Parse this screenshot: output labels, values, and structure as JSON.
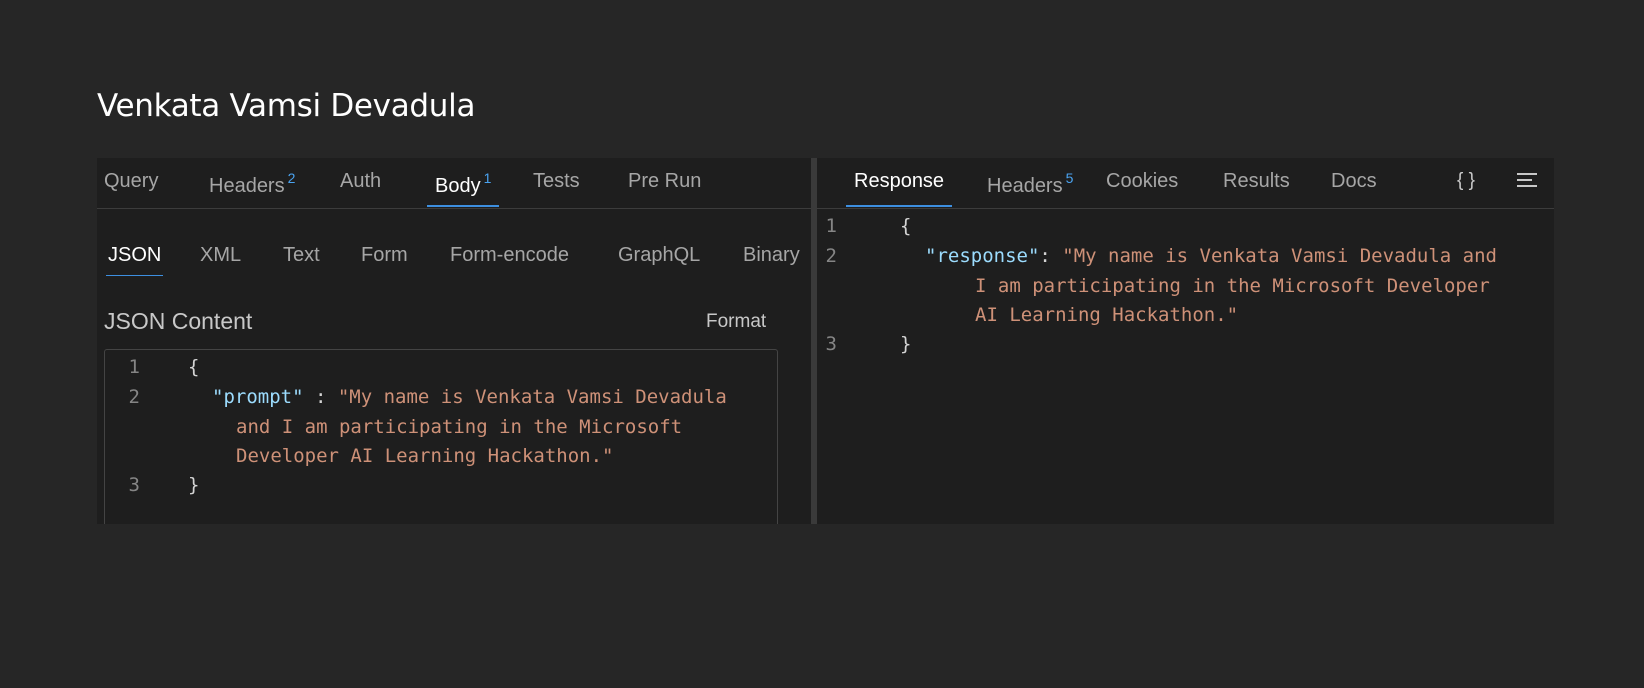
{
  "page": {
    "title": "Venkata Vamsi Devadula"
  },
  "request": {
    "tabs": [
      {
        "label": "Query",
        "badge": ""
      },
      {
        "label": "Headers",
        "badge": "2"
      },
      {
        "label": "Auth",
        "badge": ""
      },
      {
        "label": "Body",
        "badge": "1"
      },
      {
        "label": "Tests",
        "badge": ""
      },
      {
        "label": "Pre Run",
        "badge": ""
      }
    ],
    "active_tab": "Body",
    "body_tabs": [
      "JSON",
      "XML",
      "Text",
      "Form",
      "Form-encode",
      "GraphQL",
      "Binary"
    ],
    "active_body_tab": "JSON",
    "content_label": "JSON Content",
    "format_label": "Format",
    "editor": {
      "line_numbers": [
        "1",
        "2",
        "3"
      ],
      "open_brace": "{",
      "key": "\"prompt\"",
      "separator": " : ",
      "value_lines": [
        "\"My name is Venkata Vamsi Devadula",
        "and I am participating in the Microsoft",
        "Developer AI Learning Hackathon.\""
      ],
      "close_brace": "}"
    }
  },
  "response": {
    "tabs": [
      {
        "label": "Response",
        "badge": ""
      },
      {
        "label": "Headers",
        "badge": "5"
      },
      {
        "label": "Cookies",
        "badge": ""
      },
      {
        "label": "Results",
        "badge": ""
      },
      {
        "label": "Docs",
        "badge": ""
      }
    ],
    "active_tab": "Response",
    "icons": [
      {
        "name": "braces-icon",
        "glyph": "{ }"
      },
      {
        "name": "menu-lines-icon",
        "glyph": "≡"
      }
    ],
    "viewer": {
      "line_numbers": [
        "1",
        "2",
        "3"
      ],
      "open_brace": "{",
      "key": "\"response\"",
      "separator": ": ",
      "value_lines": [
        "\"My name is Venkata Vamsi Devadula and",
        "I am participating in the Microsoft Developer",
        "AI Learning Hackathon.\""
      ],
      "close_brace": "}"
    }
  },
  "colors": {
    "background": "#262626",
    "panel": "#1e1e1e",
    "accent": "#3d8fe0",
    "badge": "#4aa3f0",
    "json_key": "#9cdcfe",
    "json_string": "#ce9178"
  }
}
